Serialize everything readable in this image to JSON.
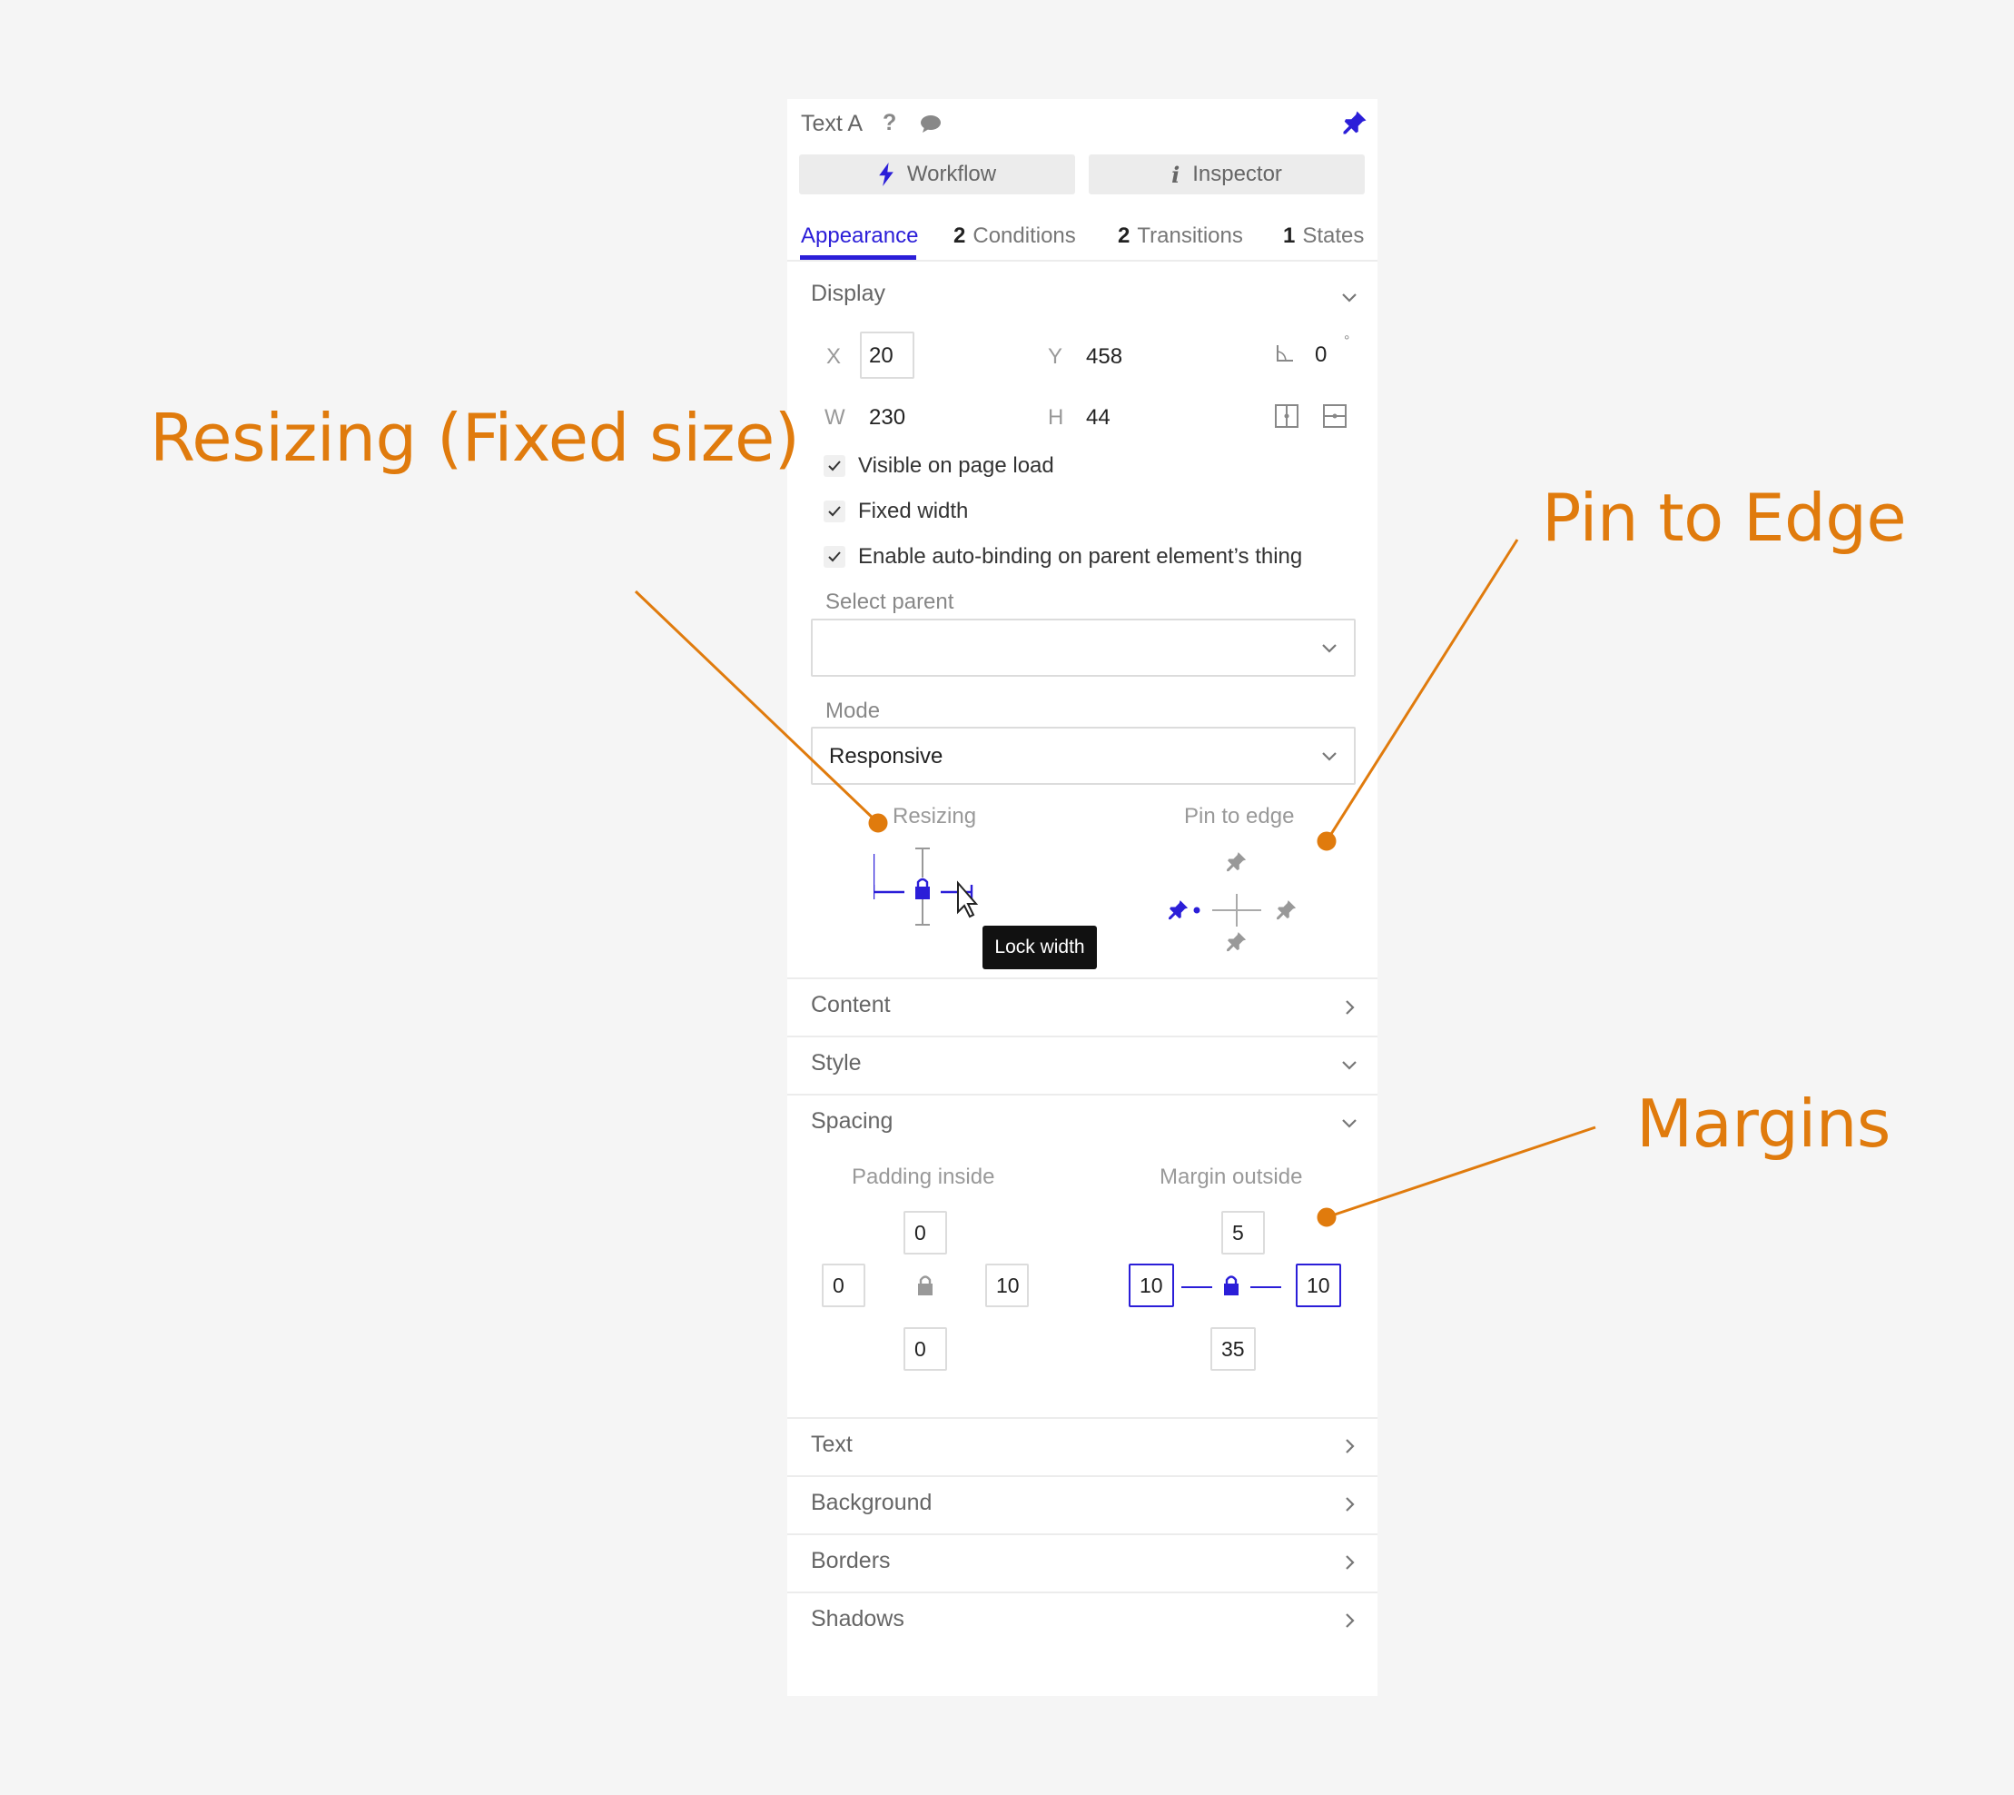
{
  "annotations": {
    "resizing": "Resizing (Fixed size)",
    "pin": "Pin to Edge",
    "margins": "Margins"
  },
  "colors": {
    "accent": "#2b1ed8",
    "annotation": "#e07b0d"
  },
  "header": {
    "title": "Text A",
    "help_icon": "question-icon",
    "comment_icon": "comment-icon",
    "pin_icon": "pin-icon"
  },
  "buttons": {
    "workflow": "Workflow",
    "inspector": "Inspector"
  },
  "tabs": {
    "appearance": "Appearance",
    "conditions_count": "2",
    "conditions": "Conditions",
    "transitions_count": "2",
    "transitions": "Transitions",
    "states_count": "1",
    "states": "States"
  },
  "display": {
    "title": "Display",
    "x_label": "X",
    "x": "20",
    "y_label": "Y",
    "y": "458",
    "rotation": "0",
    "degree": "°",
    "w_label": "W",
    "w": "230",
    "h_label": "H",
    "h": "44",
    "visible_on_load": "Visible on page load",
    "fixed_width": "Fixed width",
    "auto_binding": "Enable auto-binding on parent element’s thing",
    "select_parent_label": "Select parent",
    "select_parent_value": "",
    "mode_label": "Mode",
    "mode_value": "Responsive",
    "resizing_label": "Resizing",
    "pin_label": "Pin to edge",
    "tooltip": "Lock width"
  },
  "sections": {
    "content": "Content",
    "style": "Style",
    "spacing": "Spacing",
    "text": "Text",
    "background": "Background",
    "borders": "Borders",
    "shadows": "Shadows"
  },
  "spacing": {
    "padding_label": "Padding inside",
    "margin_label": "Margin outside",
    "padding": {
      "top": "0",
      "left": "0",
      "right": "10",
      "bottom": "0"
    },
    "margin": {
      "top": "5",
      "left": "10",
      "right": "10",
      "bottom": "35"
    }
  }
}
